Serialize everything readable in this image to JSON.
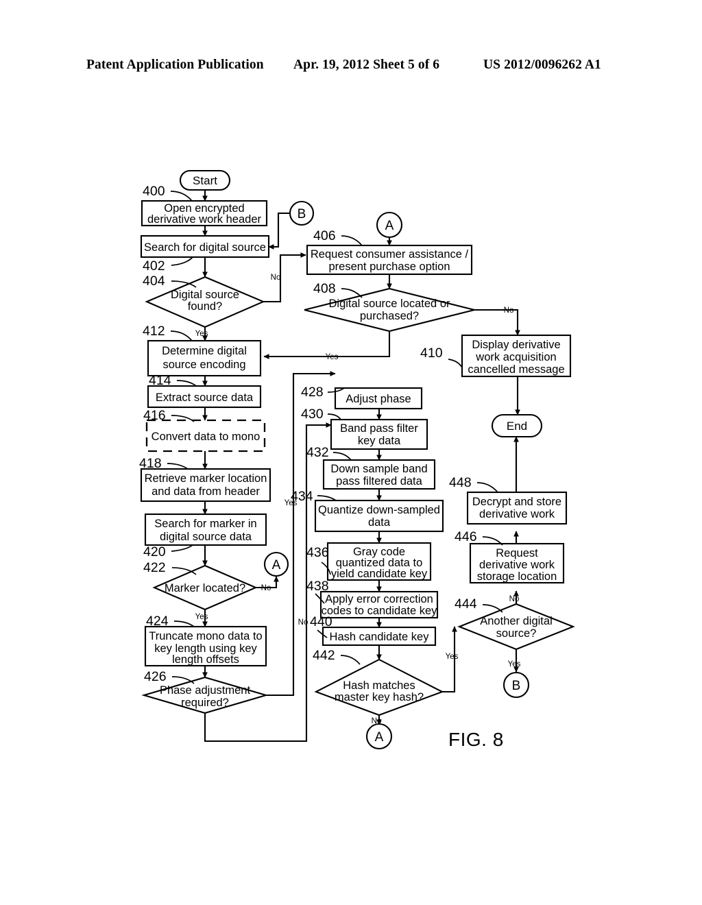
{
  "header": {
    "left": "Patent Application Publication",
    "middle": "Apr. 19, 2012  Sheet 5 of 6",
    "right": "US 2012/0096262 A1"
  },
  "figure": {
    "caption": "FIG. 8"
  },
  "flowchart": {
    "type": "flowchart",
    "terminators": [
      {
        "id": "start",
        "label": "Start"
      },
      {
        "id": "end",
        "label": "End"
      }
    ],
    "connectors": [
      {
        "id": "conn-b-top",
        "label": "B"
      },
      {
        "id": "conn-a-top",
        "label": "A"
      },
      {
        "id": "conn-a-mid",
        "label": "A"
      },
      {
        "id": "conn-a-bottom",
        "label": "A"
      },
      {
        "id": "conn-b-bottom",
        "label": "B"
      }
    ],
    "nodes": [
      {
        "ref": "400",
        "shape": "process",
        "label_lines": [
          "Open encrypted",
          "derivative work header"
        ]
      },
      {
        "ref": "402",
        "shape": "process",
        "label_lines": [
          "Search for digital source"
        ]
      },
      {
        "ref": "404",
        "shape": "decision",
        "label_lines": [
          "Digital source",
          "found?"
        ]
      },
      {
        "ref": "406",
        "shape": "process",
        "label_lines": [
          "Request consumer assistance /",
          "present purchase option"
        ]
      },
      {
        "ref": "408",
        "shape": "decision",
        "label_lines": [
          "Digital source located or",
          "purchased?"
        ]
      },
      {
        "ref": "410",
        "shape": "process",
        "label_lines": [
          "Display derivative",
          "work acquisition",
          "cancelled message"
        ]
      },
      {
        "ref": "412",
        "shape": "process",
        "label_lines": [
          "Determine digital",
          "source encoding"
        ]
      },
      {
        "ref": "414",
        "shape": "process",
        "label_lines": [
          "Extract source data"
        ]
      },
      {
        "ref": "416",
        "shape": "process-optional",
        "label_lines": [
          "Convert data to mono"
        ]
      },
      {
        "ref": "418",
        "shape": "process",
        "label_lines": [
          "Retrieve marker location",
          "and data from header"
        ]
      },
      {
        "ref": "420",
        "shape": "process",
        "label_lines": [
          "Search for marker in",
          "digital source data"
        ]
      },
      {
        "ref": "422",
        "shape": "decision",
        "label_lines": [
          "Marker located?"
        ]
      },
      {
        "ref": "424",
        "shape": "process",
        "label_lines": [
          "Truncate mono data to",
          "key length using key",
          "length offsets"
        ]
      },
      {
        "ref": "426",
        "shape": "decision",
        "label_lines": [
          "Phase adjustment",
          "required?"
        ]
      },
      {
        "ref": "428",
        "shape": "process",
        "label_lines": [
          "Adjust phase"
        ]
      },
      {
        "ref": "430",
        "shape": "process",
        "label_lines": [
          "Band pass filter",
          "key data"
        ]
      },
      {
        "ref": "432",
        "shape": "process",
        "label_lines": [
          "Down sample band",
          "pass filtered data"
        ]
      },
      {
        "ref": "434",
        "shape": "process",
        "label_lines": [
          "Quantize down-sampled",
          "data"
        ]
      },
      {
        "ref": "436",
        "shape": "process",
        "label_lines": [
          "Gray code",
          "quantized data to",
          "yield candidate key"
        ]
      },
      {
        "ref": "438",
        "shape": "process",
        "label_lines": [
          "Apply error correction",
          "codes to candidate key"
        ]
      },
      {
        "ref": "440",
        "shape": "process",
        "label_lines": [
          "Hash candidate key"
        ]
      },
      {
        "ref": "442",
        "shape": "decision",
        "label_lines": [
          "Hash matches",
          "master key hash?"
        ]
      },
      {
        "ref": "444",
        "shape": "decision",
        "label_lines": [
          "Another digital",
          "source?"
        ]
      },
      {
        "ref": "446",
        "shape": "process",
        "label_lines": [
          "Request",
          "derivative work",
          "storage location"
        ]
      },
      {
        "ref": "448",
        "shape": "process",
        "label_lines": [
          "Decrypt and store",
          "derivative work"
        ]
      }
    ],
    "edge_labels": {
      "e404_no": "No",
      "e404_yes": "Yes",
      "e408_no": "No",
      "e408_yes": "Yes",
      "e422_no": "No",
      "e422_yes": "Yes",
      "e426_yes": "Yes",
      "e426_no": "No",
      "e442_yes": "Yes",
      "e442_no": "No",
      "e444_yes": "Yes",
      "e444_no": "No"
    },
    "ref_labels": {
      "r400": "400",
      "r402": "402",
      "r404": "404",
      "r406": "406",
      "r408": "408",
      "r410": "410",
      "r412": "412",
      "r414": "414",
      "r416": "416",
      "r418": "418",
      "r420": "420",
      "r422": "422",
      "r424": "424",
      "r426": "426",
      "r428": "428",
      "r430": "430",
      "r432": "432",
      "r434": "434",
      "r436": "436",
      "r438": "438",
      "r440": "440",
      "r442": "442",
      "r444": "444",
      "r446": "446",
      "r448": "448"
    },
    "node_text": {
      "n400_l1": "Open encrypted",
      "n400_l2": "derivative work header",
      "n402_l1": "Search for digital source",
      "n404_l1": "Digital source",
      "n404_l2": "found?",
      "n406_l1": "Request consumer assistance /",
      "n406_l2": "present purchase option",
      "n408_l1": "Digital source located or",
      "n408_l2": "purchased?",
      "n410_l1": "Display derivative",
      "n410_l2": "work acquisition",
      "n410_l3": "cancelled message",
      "n412_l1": "Determine digital",
      "n412_l2": "source encoding",
      "n414_l1": "Extract source data",
      "n416_l1": "Convert data to mono",
      "n418_l1": "Retrieve marker location",
      "n418_l2": "and data from header",
      "n420_l1": "Search for marker in",
      "n420_l2": "digital source data",
      "n422_l1": "Marker located?",
      "n424_l1": "Truncate mono data to",
      "n424_l2": "key length using key",
      "n424_l3": "length offsets",
      "n426_l1": "Phase adjustment",
      "n426_l2": "required?",
      "n428_l1": "Adjust phase",
      "n430_l1": "Band pass filter",
      "n430_l2": "key data",
      "n432_l1": "Down sample band",
      "n432_l2": "pass filtered data",
      "n434_l1": "Quantize down-sampled",
      "n434_l2": "data",
      "n436_l1": "Gray code",
      "n436_l2": "quantized data to",
      "n436_l3": "yield candidate key",
      "n438_l1": "Apply error correction",
      "n438_l2": "codes to candidate key",
      "n440_l1": "Hash candidate key",
      "n442_l1": "Hash matches",
      "n442_l2": "master key hash?",
      "n444_l1": "Another digital",
      "n444_l2": "source?",
      "n446_l1": "Request",
      "n446_l2": "derivative work",
      "n446_l3": "storage location",
      "n448_l1": "Decrypt and store",
      "n448_l2": "derivative work",
      "start_l1": "Start",
      "end_l1": "End",
      "connB_top": "B",
      "connA_top": "A",
      "connA_mid": "A",
      "connA_bottom": "A",
      "connB_bottom": "B"
    }
  }
}
